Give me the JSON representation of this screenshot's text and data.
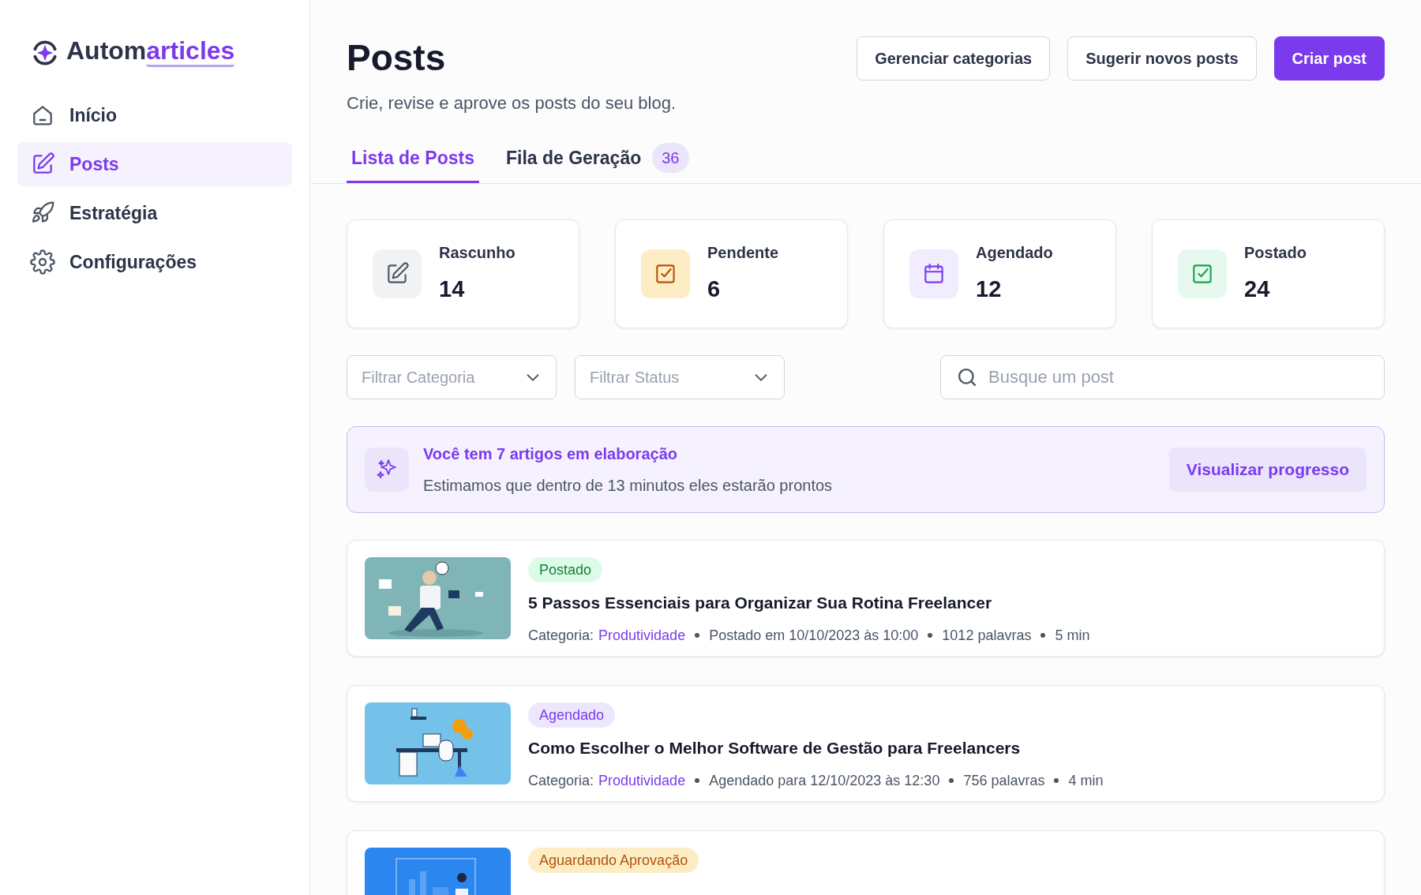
{
  "logo": {
    "part_1": "Autom",
    "part_2": "articles"
  },
  "sidebar": {
    "items": [
      {
        "label": "Início",
        "kind": "home",
        "selected": false
      },
      {
        "label": "Posts",
        "kind": "posts",
        "selected": true
      },
      {
        "label": "Estratégia",
        "kind": "strategy",
        "selected": false
      },
      {
        "label": "Configurações",
        "kind": "settings",
        "selected": false
      }
    ]
  },
  "header": {
    "title": "Posts",
    "subtitle": "Crie, revise e aprove os posts do seu blog.",
    "buttons": [
      {
        "label": "Gerenciar categorias",
        "kind": "outline"
      },
      {
        "label": "Sugerir novos posts",
        "kind": "outline"
      },
      {
        "label": "Criar post",
        "kind": "primary"
      }
    ]
  },
  "tabs": [
    {
      "label": "Lista de Posts",
      "selected": true
    },
    {
      "label": "Fila de Geração",
      "selected": false,
      "count": "36"
    }
  ],
  "stats": [
    {
      "label": "Rascunho",
      "value": "14",
      "kind": "draft"
    },
    {
      "label": "Pendente",
      "value": "6",
      "kind": "pending"
    },
    {
      "label": "Agendado",
      "value": "12",
      "kind": "scheduled"
    },
    {
      "label": "Postado",
      "value": "24",
      "kind": "posted"
    }
  ],
  "filters": [
    {
      "placeholder": "Filtrar Categoria"
    },
    {
      "placeholder": "Filtrar Status"
    }
  ],
  "search": {
    "placeholder": "Busque um post"
  },
  "banner": {
    "title": "Você tem 7 artigos em elaboração",
    "text": "Estimamos que dentro de 13 minutos eles estarão prontos",
    "button": "Visualizar progresso"
  },
  "posts": [
    {
      "status": "Postado",
      "kind": "posted",
      "title": "5 Passos Essenciais para Organizar Sua Rotina Freelancer",
      "category_label": "Categoria:",
      "category": "Produtividade",
      "details": [
        "Postado em 10/10/2023 às 10:00",
        "1012 palavras",
        "5 min"
      ]
    },
    {
      "status": "Agendado",
      "kind": "scheduled",
      "title": "Como Escolher o Melhor Software de Gestão para Freelancers",
      "category_label": "Categoria:",
      "category": "Produtividade",
      "details": [
        "Agendado para 12/10/2023 às 12:30",
        "756 palavras",
        "4 min"
      ]
    },
    {
      "status": "Aguardando Aprovação",
      "kind": "awaiting"
    }
  ]
}
